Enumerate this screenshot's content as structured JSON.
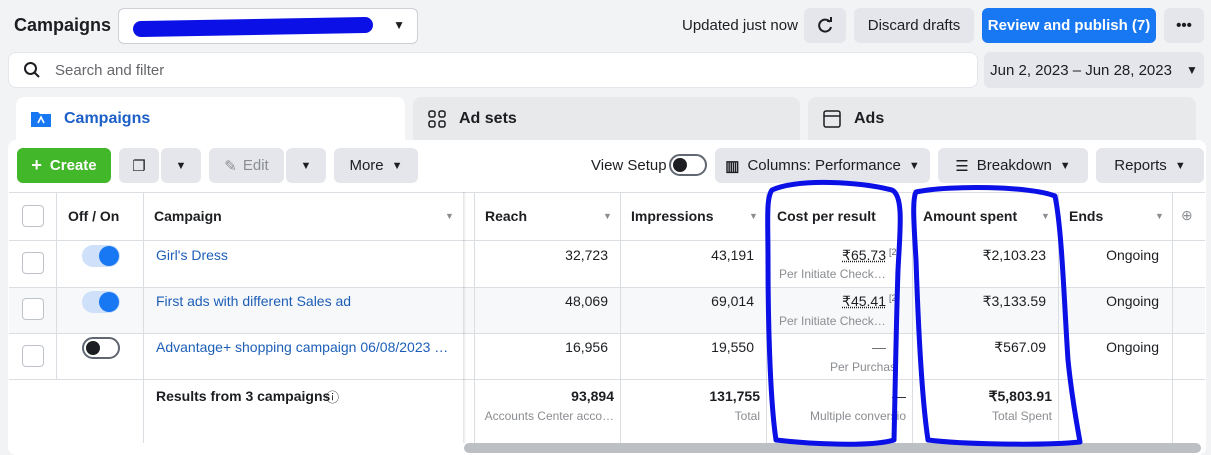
{
  "header": {
    "title": "Campaigns",
    "updated": "Updated just now",
    "discard": "Discard drafts",
    "publish": "Review and publish (7)",
    "more_icon": "ellipsis-icon"
  },
  "search": {
    "placeholder": "Search and filter"
  },
  "date_range": "Jun 2, 2023 – Jun 28, 2023",
  "tabs": [
    {
      "label": "Campaigns",
      "icon": "folder-icon"
    },
    {
      "label": "Ad sets",
      "icon": "grid-icon"
    },
    {
      "label": "Ads",
      "icon": "ad-icon"
    }
  ],
  "toolbar": {
    "create": "Create",
    "edit": "Edit",
    "more": "More",
    "view_setup": "View Setup",
    "columns": "Columns: Performance",
    "breakdown": "Breakdown",
    "reports": "Reports"
  },
  "table": {
    "headers": {
      "off_on": "Off / On",
      "campaign": "Campaign",
      "reach": "Reach",
      "impressions": "Impressions",
      "cost": "Cost per result",
      "amount": "Amount spent",
      "ends": "Ends"
    },
    "rows": [
      {
        "on": true,
        "name": "Girl's Dress",
        "reach": "32,723",
        "impressions": "43,191",
        "cost": "₹65.73",
        "cost_sup": "[2",
        "cost_sub": "Per Initiate Check…",
        "amount": "₹2,103.23",
        "ends": "Ongoing"
      },
      {
        "on": true,
        "name": "First ads with different Sales ad",
        "reach": "48,069",
        "impressions": "69,014",
        "cost": "₹45.41",
        "cost_sup": "[2",
        "cost_sub": "Per Initiate Check…",
        "amount": "₹3,133.59",
        "ends": "Ongoing"
      },
      {
        "on": false,
        "name": "Advantage+ shopping campaign 06/08/2023 …",
        "reach": "16,956",
        "impressions": "19,550",
        "cost": "—",
        "cost_sup": "",
        "cost_sub": "Per Purchas",
        "amount": "₹567.09",
        "ends": "Ongoing"
      }
    ],
    "totals": {
      "label": "Results from 3 campaigns",
      "reach": "93,894",
      "reach_sub": "Accounts Center acco…",
      "impressions": "131,755",
      "impressions_sub": "Total",
      "cost": "—",
      "cost_sub": "Multiple conversio",
      "amount": "₹5,803.91",
      "amount_sub": "Total Spent"
    }
  },
  "colors": {
    "primary": "#1877f2",
    "create": "#42b72a",
    "annotation": "#0a10e6"
  }
}
